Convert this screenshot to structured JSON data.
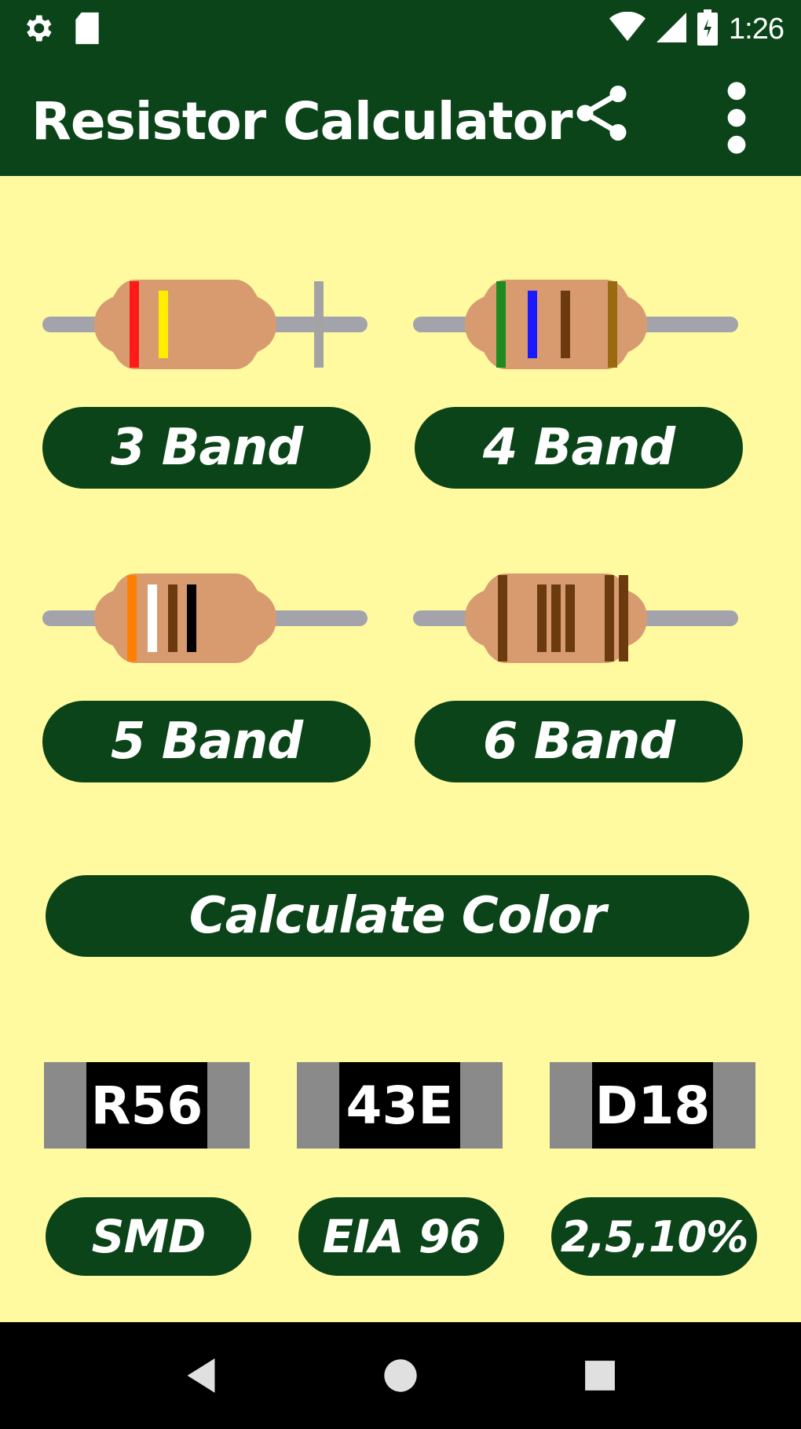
{
  "status_bar": {
    "time": "1:26",
    "icons": [
      "settings-icon",
      "sd-card-icon",
      "wifi-icon",
      "signal-icon",
      "battery-icon"
    ]
  },
  "app_bar": {
    "title": "Resistor Calculator",
    "icons": [
      "share-icon",
      "more-vert-icon"
    ]
  },
  "colors": {
    "bar": "#0b4418",
    "background": "#fffaa0",
    "resistor_body": "#d89b70",
    "lead": "#a3a3ab"
  },
  "band_options": [
    {
      "label": "3 Band",
      "bands": [
        "#ff1a1a",
        "#ffee00",
        "#a3a3a3"
      ]
    },
    {
      "label": "4 Band",
      "bands": [
        "#1f8a1f",
        "#1a1aff",
        "#6b3b0f",
        "#9a6a10"
      ]
    },
    {
      "label": "5 Band",
      "bands": [
        "#ff8000",
        "#ffffff",
        "#6b3b0f",
        "#000000"
      ]
    },
    {
      "label": "6 Band",
      "bands": [
        "#6b3b0f",
        "#6b3b0f",
        "#6b3b0f",
        "#6b3b0f",
        "#6b3b0f",
        "#6b3b0f"
      ]
    }
  ],
  "calculate_button": {
    "label": "Calculate Color"
  },
  "smd_options": [
    {
      "code": "R56",
      "label": "SMD"
    },
    {
      "code": "43E",
      "label": "EIA 96"
    },
    {
      "code": "D18",
      "label": "2,5,10%"
    }
  ],
  "nav_bar": {
    "icons": [
      "back-icon",
      "home-icon",
      "recents-icon"
    ]
  }
}
